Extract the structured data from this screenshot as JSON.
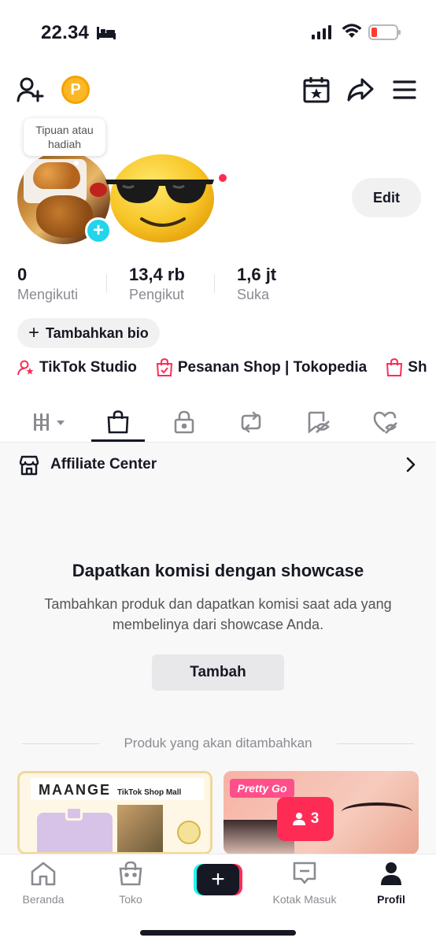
{
  "status_bar": {
    "time": "22.34"
  },
  "profile": {
    "tooltip": "Tipuan atau hadiah",
    "edit_label": "Edit",
    "stats": [
      {
        "value": "0",
        "label": "Mengikuti"
      },
      {
        "value": "13,4 rb",
        "label": "Pengikut"
      },
      {
        "value": "1,6 jt",
        "label": "Suka"
      }
    ],
    "bio_button": "Tambahkan bio",
    "coin_letter": "P"
  },
  "links": [
    {
      "label": "TikTok Studio",
      "icon": "person-star-icon"
    },
    {
      "label": "Pesanan Shop | Tokopedia",
      "icon": "shopping-bag-check-icon"
    },
    {
      "label": "Sh",
      "icon": "shopping-bag-icon"
    }
  ],
  "tabs": [
    {
      "icon": "grid-menu-icon",
      "active": false
    },
    {
      "icon": "shopping-bag-icon",
      "active": true
    },
    {
      "icon": "lock-icon",
      "active": false
    },
    {
      "icon": "repost-icon",
      "active": false
    },
    {
      "icon": "eye-slash-tag-icon",
      "active": false
    },
    {
      "icon": "heart-slash-icon",
      "active": false
    }
  ],
  "affiliate": {
    "label": "Affiliate Center"
  },
  "showcase": {
    "title": "Dapatkan komisi dengan showcase",
    "description": "Tambahkan produk dan dapatkan komisi saat ada yang membelinya dari showcase Anda.",
    "button": "Tambah",
    "products_label": "Produk yang akan ditambahkan"
  },
  "products": [
    {
      "brand": "MAANGE",
      "tag": "TikTok Shop Mall"
    },
    {
      "brand": "Pretty Go"
    }
  ],
  "live_badge": {
    "count": "3"
  },
  "bottom_nav": [
    {
      "label": "Beranda",
      "icon": "home-icon",
      "active": false
    },
    {
      "label": "Toko",
      "icon": "shop-bag-icon",
      "active": false
    },
    {
      "label": "Kotak Masuk",
      "icon": "inbox-icon",
      "active": false
    },
    {
      "label": "Profil",
      "icon": "profile-icon",
      "active": true
    }
  ],
  "colors": {
    "accent": "#fe2c55",
    "cyan": "#20d5ec",
    "coin": "#fbb726",
    "text": "#161823",
    "muted": "#8a8b91"
  }
}
